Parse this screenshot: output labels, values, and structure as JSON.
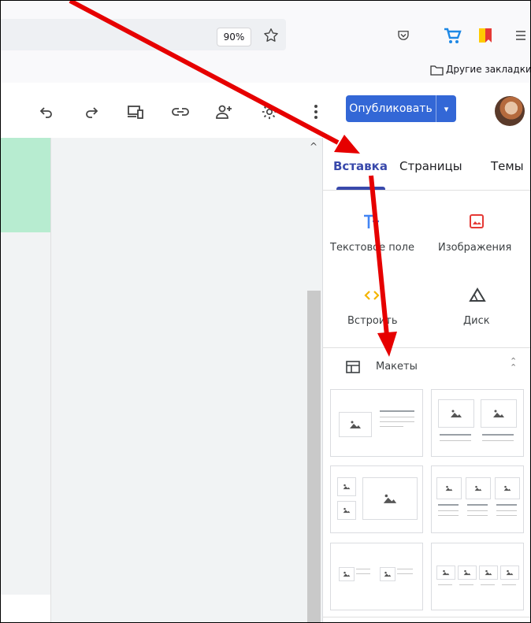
{
  "browser": {
    "zoom": "90%",
    "bookmarks_other": "Другие закладки"
  },
  "toolbar": {
    "publish_label": "Опубликовать"
  },
  "panel": {
    "tabs": [
      {
        "label": "Вставка",
        "active": true
      },
      {
        "label": "Страницы",
        "active": false
      },
      {
        "label": "Темы",
        "active": false
      }
    ],
    "tools": [
      {
        "label": "Текстовое поле",
        "icon": "text-box-icon"
      },
      {
        "label": "Изображения",
        "icon": "image-icon"
      },
      {
        "label": "Встроить",
        "icon": "embed-icon"
      },
      {
        "label": "Диск",
        "icon": "drive-icon"
      }
    ],
    "layouts_label": "Макеты"
  },
  "colors": {
    "accent": "#3367d6",
    "tab_active": "#3949ab",
    "annotation": "#e60000",
    "canvas_green": "#b7ecd0"
  }
}
